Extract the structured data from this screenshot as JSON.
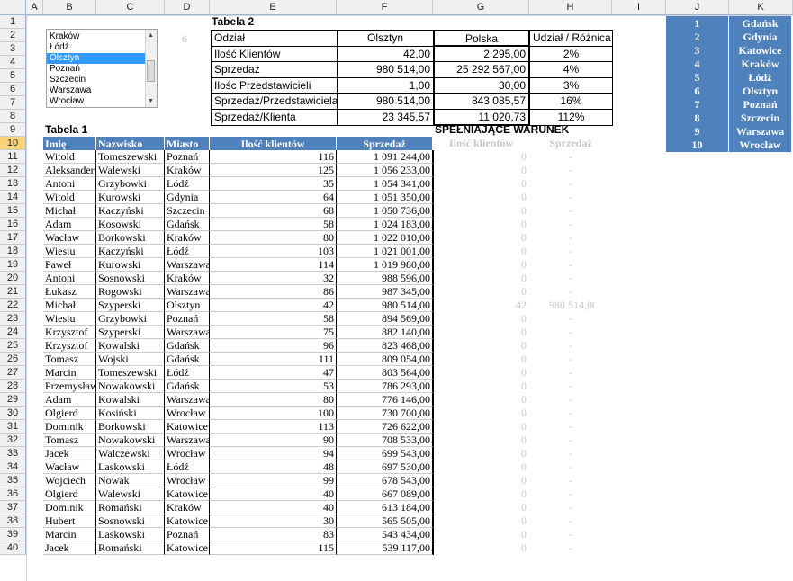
{
  "columns": [
    "A",
    "B",
    "C",
    "D",
    "E",
    "F",
    "G",
    "H",
    "I",
    "J",
    "K"
  ],
  "rows": [
    "1",
    "2",
    "3",
    "4",
    "5",
    "6",
    "7",
    "8",
    "9",
    "10",
    "11",
    "12",
    "13",
    "14",
    "15",
    "16",
    "17",
    "18",
    "19",
    "20",
    "21",
    "22",
    "23",
    "24",
    "25",
    "26",
    "27",
    "28",
    "29",
    "30",
    "31",
    "32",
    "33",
    "34",
    "35",
    "36",
    "37",
    "38",
    "39",
    "40"
  ],
  "active_row": "10",
  "listbox": {
    "items": [
      "Kraków",
      "Łódź",
      "Olsztyn",
      "Poznań",
      "Szczecin",
      "Warszawa",
      "Wrocław"
    ],
    "selected_index": 2,
    "linked_value": "6"
  },
  "tabela2": {
    "title": "Tabela 2",
    "headers": [
      "Odział",
      "Olsztyn",
      "Polska",
      "Udział / Różnica"
    ],
    "rows": [
      [
        "Ilość Klientów",
        "42,00",
        "2 295,00",
        "2%"
      ],
      [
        "Sprzedaż",
        "980 514,00",
        "25 292 567,00",
        "4%"
      ],
      [
        "Ilośc Przedstawicieli",
        "1,00",
        "30,00",
        "3%"
      ],
      [
        "Sprzedaż/Przedstawiciela",
        "980 514,00",
        "843 085,57",
        "16%"
      ],
      [
        "Sprzedaż/Klienta",
        "23 345,57",
        "11 020,73",
        "112%"
      ]
    ]
  },
  "tabela1": {
    "title": "Tabela 1",
    "headers": [
      "Imię",
      "Nazwisko",
      "Miasto",
      "Ilość klientów",
      "Sprzedaż"
    ],
    "rows": [
      [
        "Witold",
        "Tomeszewski",
        "Poznań",
        "116",
        "1 091 244,00"
      ],
      [
        "Aleksander",
        "Walewski",
        "Kraków",
        "125",
        "1 056 233,00"
      ],
      [
        "Antoni",
        "Grzybowki",
        "Łódź",
        "35",
        "1 054 341,00"
      ],
      [
        "Witold",
        "Kurowski",
        "Gdynia",
        "64",
        "1 051 350,00"
      ],
      [
        "Michał",
        "Kaczyński",
        "Szczecin",
        "68",
        "1 050 736,00"
      ],
      [
        "Adam",
        "Kosowski",
        "Gdańsk",
        "58",
        "1 024 183,00"
      ],
      [
        "Wacław",
        "Borkowski",
        "Kraków",
        "80",
        "1 022 010,00"
      ],
      [
        "Wiesiu",
        "Kaczyński",
        "Łódź",
        "103",
        "1 021 001,00"
      ],
      [
        "Paweł",
        "Kurowski",
        "Warszawa",
        "114",
        "1 019 980,00"
      ],
      [
        "Antoni",
        "Sosnowski",
        "Kraków",
        "32",
        "988 596,00"
      ],
      [
        "Łukasz",
        "Rogowski",
        "Warszawa",
        "86",
        "987 345,00"
      ],
      [
        "Michał",
        "Szyperski",
        "Olsztyn",
        "42",
        "980 514,00"
      ],
      [
        "Wiesiu",
        "Grzybowki",
        "Poznań",
        "58",
        "894 569,00"
      ],
      [
        "Krzysztof",
        "Szyperski",
        "Warszawa",
        "75",
        "882 140,00"
      ],
      [
        "Krzysztof",
        "Kowalski",
        "Gdańsk",
        "96",
        "823 468,00"
      ],
      [
        "Tomasz",
        "Wojski",
        "Gdańsk",
        "111",
        "809 054,00"
      ],
      [
        "Marcin",
        "Tomeszewski",
        "Łódź",
        "47",
        "803 564,00"
      ],
      [
        "Przemysław",
        "Nowakowski",
        "Gdańsk",
        "53",
        "786 293,00"
      ],
      [
        "Adam",
        "Kowalski",
        "Warszawa",
        "80",
        "776 146,00"
      ],
      [
        "Olgierd",
        "Kosiński",
        "Wrocław",
        "100",
        "730 700,00"
      ],
      [
        "Dominik",
        "Borkowski",
        "Katowice",
        "113",
        "726 622,00"
      ],
      [
        "Tomasz",
        "Nowakowski",
        "Warszawa",
        "90",
        "708 533,00"
      ],
      [
        "Jacek",
        "Walczewski",
        "Wrocław",
        "94",
        "699 543,00"
      ],
      [
        "Wacław",
        "Laskowski",
        "Łódź",
        "48",
        "697 530,00"
      ],
      [
        "Wojciech",
        "Nowak",
        "Wrocław",
        "99",
        "678 543,00"
      ],
      [
        "Olgierd",
        "Walewski",
        "Katowice",
        "40",
        "667 089,00"
      ],
      [
        "Dominik",
        "Romański",
        "Kraków",
        "40",
        "613 184,00"
      ],
      [
        "Hubert",
        "Sosnowski",
        "Katowice",
        "30",
        "565 505,00"
      ],
      [
        "Marcin",
        "Laskowski",
        "Poznań",
        "83",
        "543 434,00"
      ],
      [
        "Jacek",
        "Romański",
        "Katowice",
        "115",
        "539 117,00"
      ]
    ]
  },
  "spelniajace": {
    "title": "SPEŁNIAJĄCE WARUNEK",
    "headers": [
      "Ilość klientów",
      "Sprzedaż"
    ],
    "rows": [
      [
        "0",
        "-"
      ],
      [
        "0",
        "-"
      ],
      [
        "0",
        "-"
      ],
      [
        "0",
        "-"
      ],
      [
        "0",
        "-"
      ],
      [
        "0",
        "-"
      ],
      [
        "0",
        "-"
      ],
      [
        "0",
        "-"
      ],
      [
        "0",
        "-"
      ],
      [
        "0",
        "-"
      ],
      [
        "0",
        "-"
      ],
      [
        "42",
        "980 514,00"
      ],
      [
        "0",
        "-"
      ],
      [
        "0",
        "-"
      ],
      [
        "0",
        "-"
      ],
      [
        "0",
        "-"
      ],
      [
        "0",
        "-"
      ],
      [
        "0",
        "-"
      ],
      [
        "0",
        "-"
      ],
      [
        "0",
        "-"
      ],
      [
        "0",
        "-"
      ],
      [
        "0",
        "-"
      ],
      [
        "0",
        "-"
      ],
      [
        "0",
        "-"
      ],
      [
        "0",
        "-"
      ],
      [
        "0",
        "-"
      ],
      [
        "0",
        "-"
      ],
      [
        "0",
        "-"
      ],
      [
        "0",
        "-"
      ],
      [
        "0",
        "-"
      ]
    ]
  },
  "cities_list": [
    [
      "1",
      "Gdańsk"
    ],
    [
      "2",
      "Gdynia"
    ],
    [
      "3",
      "Katowice"
    ],
    [
      "4",
      "Kraków"
    ],
    [
      "5",
      "Łódź"
    ],
    [
      "6",
      "Olsztyn"
    ],
    [
      "7",
      "Poznań"
    ],
    [
      "8",
      "Szczecin"
    ],
    [
      "9",
      "Warszawa"
    ],
    [
      "10",
      "Wrocław"
    ]
  ],
  "colors": {
    "header_blue": "#4f81bd",
    "selection": "#3399ff",
    "active_header": "#f8d378"
  }
}
